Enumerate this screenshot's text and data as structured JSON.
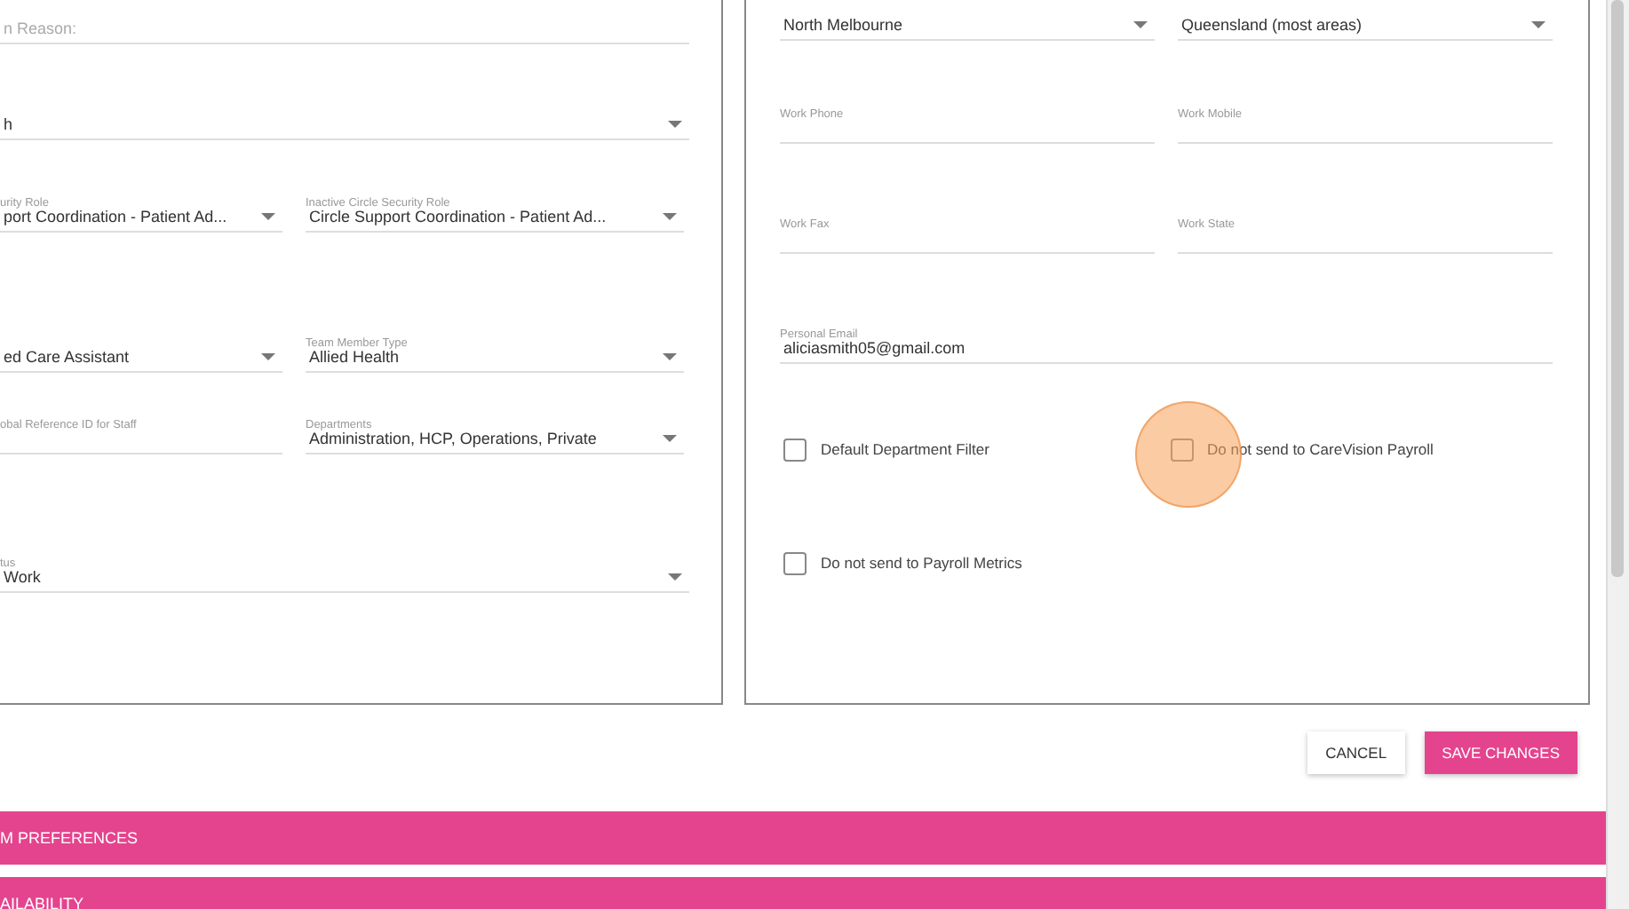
{
  "left_panel": {
    "rows": [
      {
        "fields": [
          {
            "kind": "text",
            "placeholder": "n Reason:"
          }
        ]
      },
      {
        "fields": [
          {
            "kind": "select",
            "value": "h"
          }
        ]
      },
      {
        "fields": [
          {
            "kind": "select",
            "label": "urity Role",
            "value": "port Coordination - Patient Ad..."
          },
          {
            "kind": "select",
            "label": "Inactive Circle Security Role",
            "value": "Circle Support Coordination - Patient Ad..."
          }
        ]
      },
      {
        "fields": [
          {
            "kind": "select",
            "value": "ed Care Assistant"
          },
          {
            "kind": "select",
            "label": "Team Member Type",
            "value": "Allied Health"
          }
        ]
      },
      {
        "fields": [
          {
            "kind": "text",
            "label": "obal Reference ID for Staff"
          },
          {
            "kind": "select",
            "label": "Departments",
            "value": "Administration, HCP, Operations, Private"
          }
        ]
      },
      {
        "fields": [
          {
            "kind": "select",
            "label": "tus",
            "value": "Work"
          }
        ]
      }
    ]
  },
  "right_panel": {
    "rows": [
      {
        "fields": [
          {
            "kind": "select",
            "value": "North Melbourne"
          },
          {
            "kind": "select",
            "value": "Queensland (most areas)"
          }
        ]
      },
      {
        "fields": [
          {
            "kind": "text",
            "label": "Work Phone"
          },
          {
            "kind": "text",
            "label": "Work Mobile"
          }
        ]
      },
      {
        "fields": [
          {
            "kind": "text",
            "label": "Work Fax"
          },
          {
            "kind": "text",
            "label": "Work State"
          }
        ]
      },
      {
        "fields": [
          {
            "kind": "text",
            "label": "Personal Email",
            "value": "aliciasmith05@gmail.com"
          }
        ]
      }
    ],
    "checkbox_rows": [
      [
        {
          "label": "Default Department Filter",
          "checked": false
        },
        {
          "label": "Do not send to CareVision Payroll",
          "checked": false
        }
      ],
      [
        {
          "label": "Do not send to Payroll Metrics",
          "checked": false
        }
      ]
    ]
  },
  "buttons": [
    {
      "label": "CANCEL",
      "kind": "secondary"
    },
    {
      "label": "SAVE CHANGES",
      "kind": "primary"
    }
  ],
  "sections": [
    {
      "title": "M PREFERENCES"
    },
    {
      "title": "AILABILITY"
    }
  ]
}
